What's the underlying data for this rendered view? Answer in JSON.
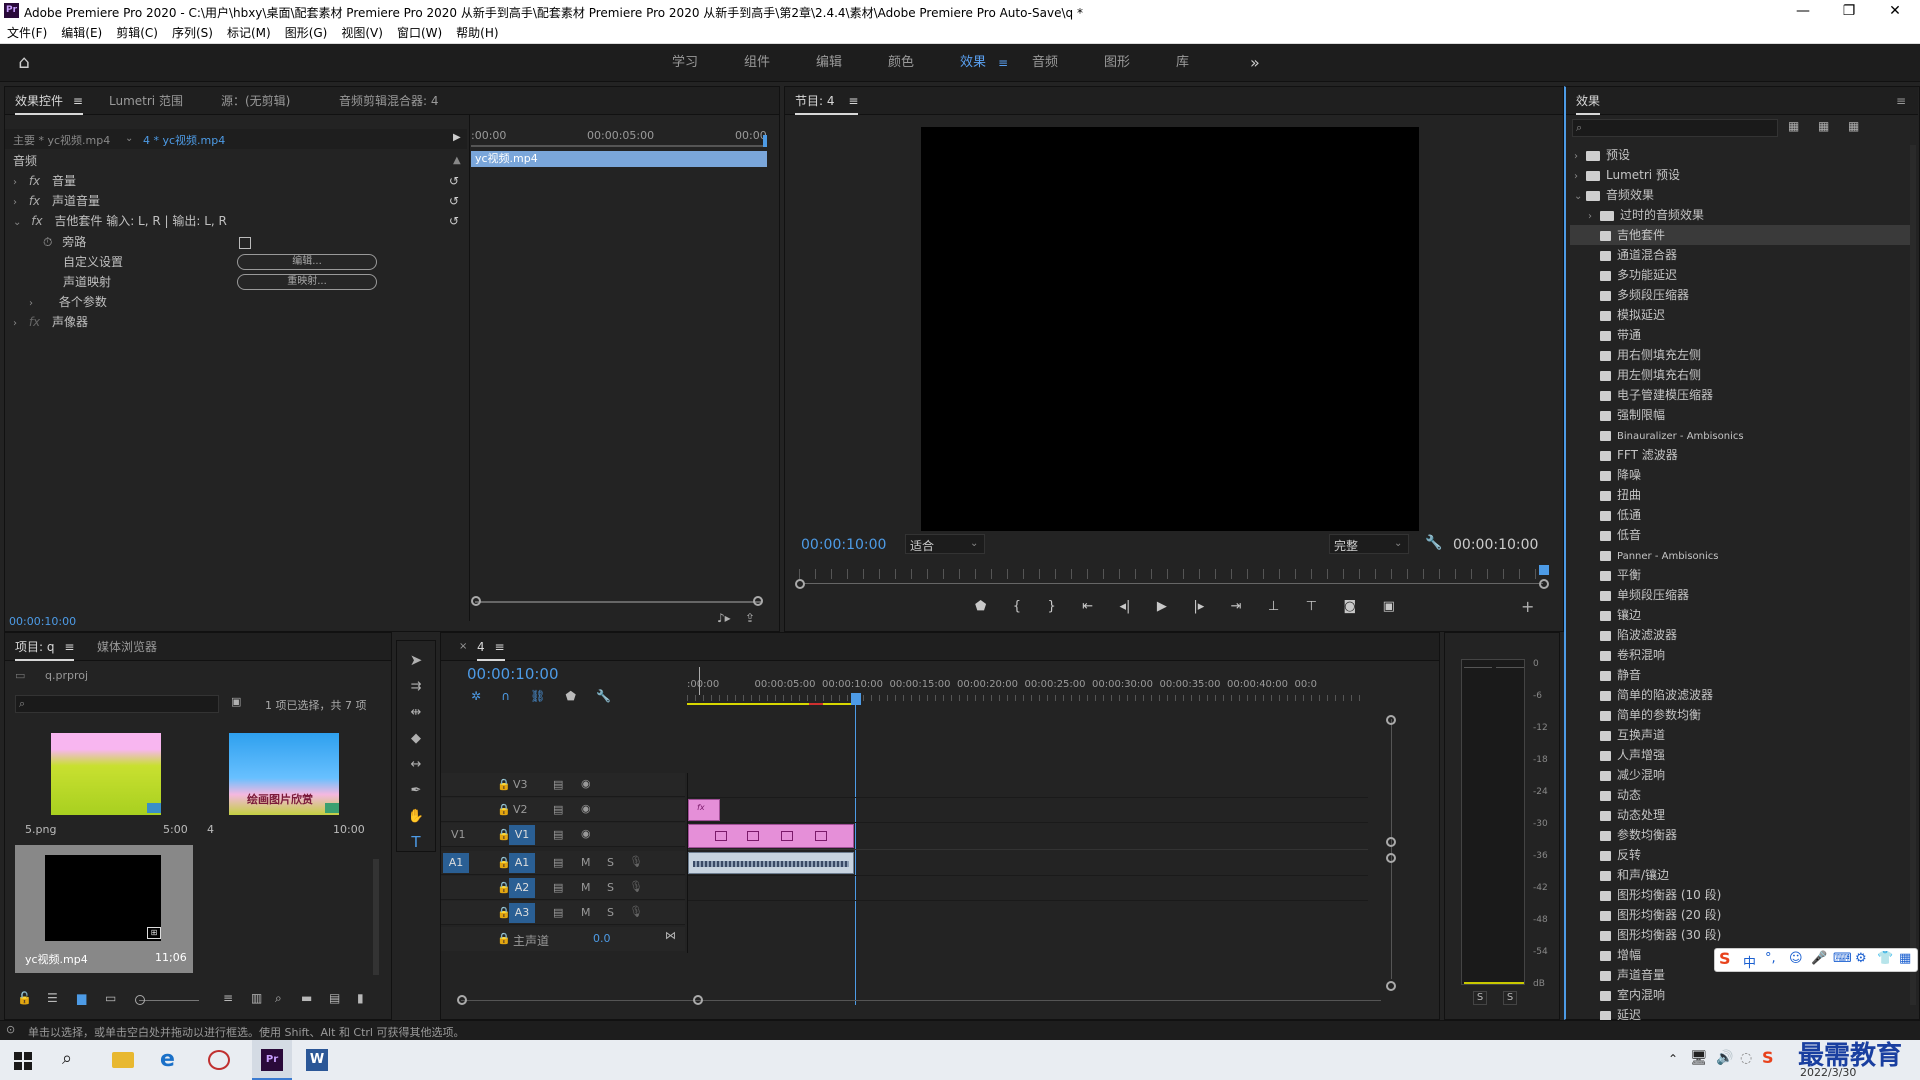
{
  "window": {
    "app_badge": "Pr",
    "title": "Adobe Premiere Pro 2020 - C:\\用户\\hbxy\\桌面\\配套素材 Premiere Pro 2020 从新手到高手\\配套素材 Premiere Pro 2020 从新手到高手\\第2章\\2.4.4\\素材\\Adobe Premiere Pro Auto-Save\\q *",
    "controls": [
      "—",
      "❐",
      "✕"
    ]
  },
  "menu": [
    "文件(F)",
    "编辑(E)",
    "剪辑(C)",
    "序列(S)",
    "标记(M)",
    "图形(G)",
    "视图(V)",
    "窗口(W)",
    "帮助(H)"
  ],
  "workspaces": {
    "items": [
      "学习",
      "组件",
      "编辑",
      "颜色",
      "效果",
      "音频",
      "图形",
      "库"
    ],
    "active": "效果",
    "more": "»"
  },
  "effect_controls": {
    "tabs": [
      "效果控件",
      "Lumetri 范围",
      "源：(无剪辑)",
      "音频剪辑混合器: 4"
    ],
    "master": "主要 * yc视频.mp4",
    "clip": "4 * yc视频.mp4",
    "ruler": [
      ":00:00",
      "00:00:05:00",
      "00:00"
    ],
    "clip_bar": "yc视频.mp4",
    "section": "音频",
    "rows": {
      "volume": "音量",
      "channel_volume": "声道音量",
      "guitar_suite": "吉他套件 输入: L, R | 输出: L, R",
      "bypass": "旁路",
      "custom_setup": "自定义设置",
      "channel_map": "声道映射",
      "params": "各个参数",
      "panner": "声像器"
    },
    "edit_btn": "编辑...",
    "remap_btn": "重映射...",
    "fx": "fx",
    "timecode": "00:00:10:00"
  },
  "program": {
    "title": "节目: 4",
    "timecode": "00:00:10:00",
    "fit": "适合",
    "quality": "完整",
    "duration": "00:00:10:00"
  },
  "project": {
    "tabs": [
      "项目: q",
      "媒体浏览器"
    ],
    "file": "q.prproj",
    "selection": "1 项已选择，共 7 项",
    "items": [
      {
        "name": "5.png",
        "dur": "5:00"
      },
      {
        "name": "4",
        "dur": "10:00",
        "caption": "绘画图片欣赏"
      },
      {
        "name": "yc视频.mp4",
        "dur": "11;06"
      }
    ]
  },
  "timeline": {
    "tab": "4",
    "timecode": "00:00:10:00",
    "ruler": [
      ":00:00",
      "00:00:05:00",
      "00:00:10:00",
      "00:00:15:00",
      "00:00:20:00",
      "00:00:25:00",
      "00:00:30:00",
      "00:00:35:00",
      "00:00:40:00",
      "00:0"
    ],
    "video_tracks": [
      "V3",
      "V2",
      "V1"
    ],
    "audio_tracks": [
      "A1",
      "A2",
      "A3"
    ],
    "source_v": "V1",
    "source_a": "A1",
    "master": "主声道",
    "master_val": "0.0",
    "ms": [
      "M",
      "S"
    ],
    "fx": "fx"
  },
  "meter": {
    "scale": [
      "0",
      "-6",
      "-12",
      "-18",
      "-24",
      "-30",
      "-36",
      "-42",
      "-48",
      "-54",
      "dB"
    ],
    "solo": [
      "S",
      "S"
    ]
  },
  "effects": {
    "title": "效果",
    "tree": [
      {
        "label": "预设",
        "level": 0,
        "type": "folder",
        "arrow": "›"
      },
      {
        "label": "Lumetri 预设",
        "level": 0,
        "type": "folder",
        "arrow": "›"
      },
      {
        "label": "音频效果",
        "level": 0,
        "type": "folder",
        "arrow": "⌄"
      },
      {
        "label": "过时的音频效果",
        "level": 1,
        "type": "folder",
        "arrow": "›"
      },
      {
        "label": "吉他套件",
        "level": 1,
        "type": "fx",
        "selected": true
      },
      {
        "label": "通道混合器",
        "level": 1,
        "type": "fx"
      },
      {
        "label": "多功能延迟",
        "level": 1,
        "type": "fx"
      },
      {
        "label": "多频段压缩器",
        "level": 1,
        "type": "fx"
      },
      {
        "label": "模拟延迟",
        "level": 1,
        "type": "fx"
      },
      {
        "label": "带通",
        "level": 1,
        "type": "fx"
      },
      {
        "label": "用右侧填充左侧",
        "level": 1,
        "type": "fx"
      },
      {
        "label": "用左侧填充右侧",
        "level": 1,
        "type": "fx"
      },
      {
        "label": "电子管建模压缩器",
        "level": 1,
        "type": "fx"
      },
      {
        "label": "强制限幅",
        "level": 1,
        "type": "fx"
      },
      {
        "label": "Binauralizer - Ambisonics",
        "level": 1,
        "type": "fx"
      },
      {
        "label": "FFT 滤波器",
        "level": 1,
        "type": "fx"
      },
      {
        "label": "降噪",
        "level": 1,
        "type": "fx"
      },
      {
        "label": "扭曲",
        "level": 1,
        "type": "fx"
      },
      {
        "label": "低通",
        "level": 1,
        "type": "fx"
      },
      {
        "label": "低音",
        "level": 1,
        "type": "fx"
      },
      {
        "label": "Panner - Ambisonics",
        "level": 1,
        "type": "fx"
      },
      {
        "label": "平衡",
        "level": 1,
        "type": "fx"
      },
      {
        "label": "单频段压缩器",
        "level": 1,
        "type": "fx"
      },
      {
        "label": "镶边",
        "level": 1,
        "type": "fx"
      },
      {
        "label": "陷波滤波器",
        "level": 1,
        "type": "fx"
      },
      {
        "label": "卷积混响",
        "level": 1,
        "type": "fx"
      },
      {
        "label": "静音",
        "level": 1,
        "type": "fx"
      },
      {
        "label": "简单的陷波滤波器",
        "level": 1,
        "type": "fx"
      },
      {
        "label": "简单的参数均衡",
        "level": 1,
        "type": "fx"
      },
      {
        "label": "互换声道",
        "level": 1,
        "type": "fx"
      },
      {
        "label": "人声增强",
        "level": 1,
        "type": "fx"
      },
      {
        "label": "减少混响",
        "level": 1,
        "type": "fx"
      },
      {
        "label": "动态",
        "level": 1,
        "type": "fx"
      },
      {
        "label": "动态处理",
        "level": 1,
        "type": "fx"
      },
      {
        "label": "参数均衡器",
        "level": 1,
        "type": "fx"
      },
      {
        "label": "反转",
        "level": 1,
        "type": "fx"
      },
      {
        "label": "和声/镶边",
        "level": 1,
        "type": "fx"
      },
      {
        "label": "图形均衡器 (10 段)",
        "level": 1,
        "type": "fx"
      },
      {
        "label": "图形均衡器 (20 段)",
        "level": 1,
        "type": "fx"
      },
      {
        "label": "图形均衡器 (30 段)",
        "level": 1,
        "type": "fx"
      },
      {
        "label": "增幅",
        "level": 1,
        "type": "fx"
      },
      {
        "label": "声道音量",
        "level": 1,
        "type": "fx"
      },
      {
        "label": "室内混响",
        "level": 1,
        "type": "fx"
      },
      {
        "label": "延迟",
        "level": 1,
        "type": "fx"
      }
    ]
  },
  "status": "单击以选择，或单击空白处并拖动以进行框选。使用 Shift、Alt 和 Ctrl 可获得其他选项。",
  "ime": {
    "brand": "S",
    "mode": "中"
  },
  "watermark": {
    "brand": "最需教育",
    "date": "2022/3/30"
  }
}
